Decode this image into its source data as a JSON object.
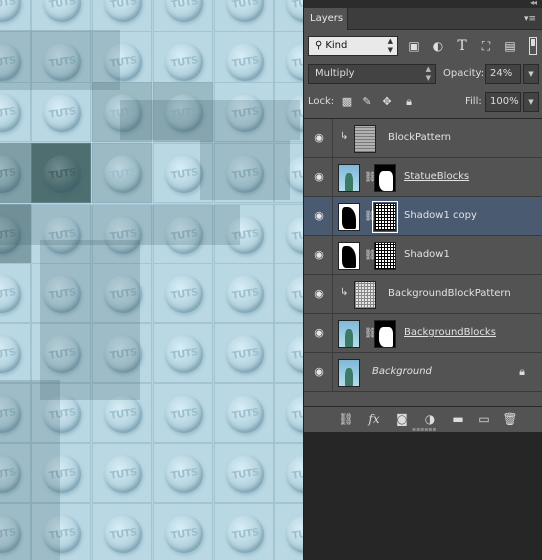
{
  "panel": {
    "title": "Layers",
    "collapse_glyph": "◂◂",
    "menu_glyph": "▾≡"
  },
  "filter": {
    "search_glyph": "⚲",
    "kind_label": "Kind",
    "icons": [
      "image-filter-icon",
      "adjustment-filter-icon",
      "type-filter-icon",
      "shape-filter-icon",
      "smart-object-filter-icon"
    ]
  },
  "blend": {
    "mode": "Multiply",
    "opacity_label": "Opacity:",
    "opacity_value": "24%",
    "fill_label": "Fill:",
    "fill_value": "100%"
  },
  "lock": {
    "label": "Lock:"
  },
  "layers": [
    {
      "name": "BlockPattern",
      "clipped": true,
      "thumb": "pattern",
      "mask": null,
      "selected": false,
      "style": ""
    },
    {
      "name": "StatueBlocks",
      "clipped": false,
      "thumb": "statue",
      "mask": "mask-wb",
      "selected": false,
      "style": "ul"
    },
    {
      "name": "Shadow1 copy",
      "clipped": false,
      "thumb": "mask-bw",
      "mask": "mask-grid",
      "selected": true,
      "style": ""
    },
    {
      "name": "Shadow1",
      "clipped": false,
      "thumb": "mask-bw",
      "mask": "mask-grid",
      "selected": false,
      "style": ""
    },
    {
      "name": "BackgroundBlockPattern",
      "clipped": true,
      "thumb": "pattern2",
      "mask": null,
      "selected": false,
      "style": ""
    },
    {
      "name": "BackgroundBlocks",
      "clipped": false,
      "thumb": "statue",
      "mask": "mask-wb",
      "selected": false,
      "style": "ul"
    },
    {
      "name": "Background",
      "clipped": false,
      "thumb": "statue",
      "mask": null,
      "selected": false,
      "style": "it",
      "locked": true
    }
  ],
  "canvas": {
    "stud_text": "TUTS"
  }
}
